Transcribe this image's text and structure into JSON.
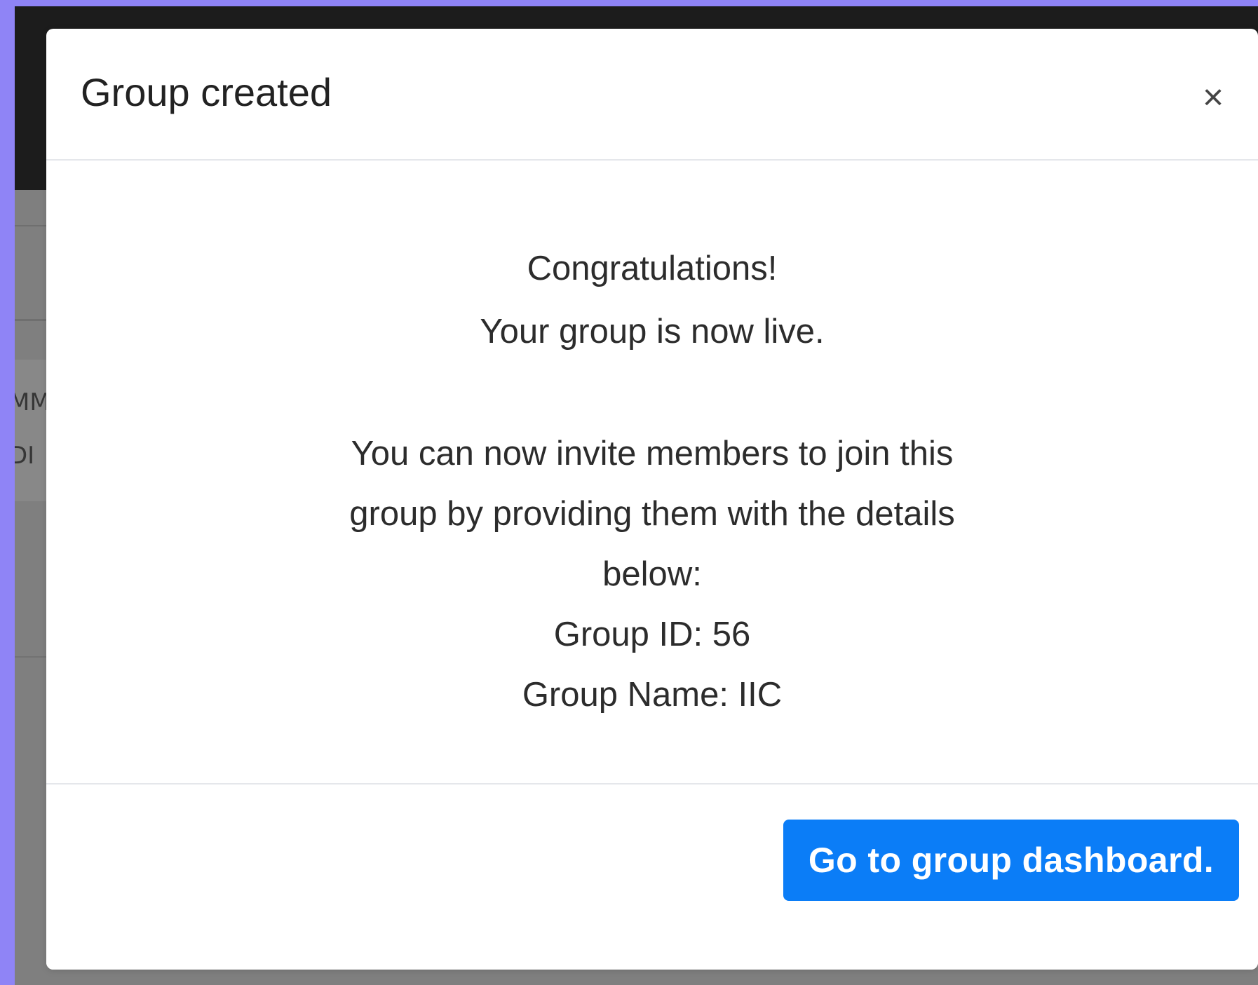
{
  "modal": {
    "title": "Group created",
    "close_label": "×",
    "body": {
      "congrats": "Congratulations!",
      "live": "Your group is now live.",
      "invite_line_1": "You can now invite members to join this",
      "invite_line_2": "group by providing them with the details",
      "invite_line_3": "below:",
      "group_id": "Group ID: 56",
      "group_name": "Group Name: IIC"
    },
    "primary_button": "Go to group dashboard."
  },
  "background_fragments": {
    "line_1": "MM",
    "line_2": "DI"
  },
  "colors": {
    "frame": "#8f84f6",
    "overlay": "#7f7f7f",
    "topbar": "#1c1c1c",
    "modal": "#ffffff",
    "button": "#0b7df7"
  }
}
